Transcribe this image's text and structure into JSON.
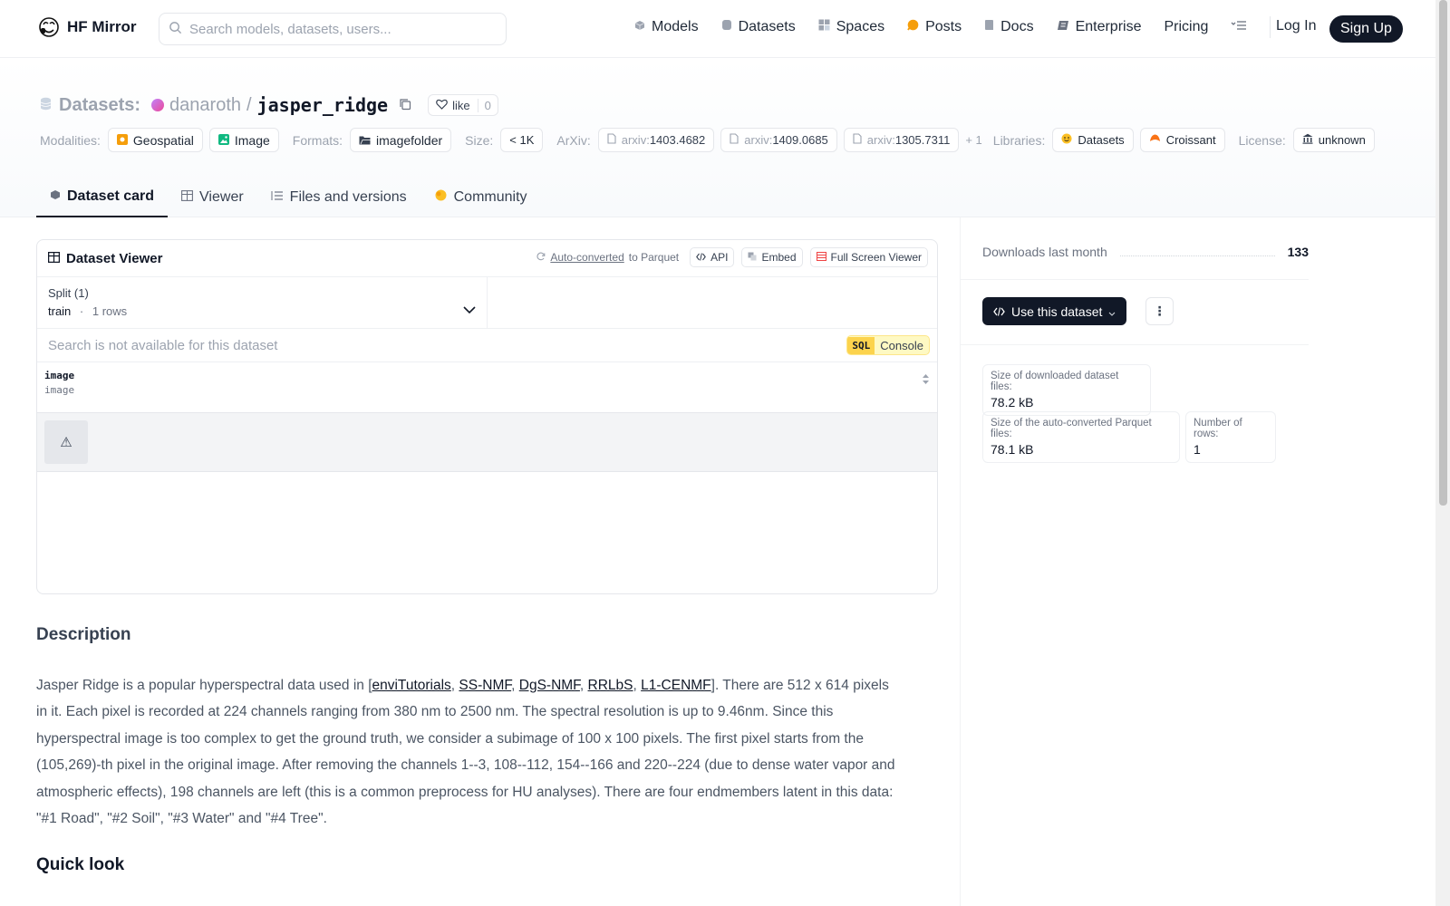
{
  "header": {
    "brand": "HF Mirror",
    "search_placeholder": "Search models, datasets, users...",
    "nav": [
      {
        "label": "Models",
        "icon": "cube-icon",
        "color": "#9ca3af"
      },
      {
        "label": "Datasets",
        "icon": "database-icon",
        "color": "#9ca3af"
      },
      {
        "label": "Spaces",
        "icon": "grid-icon",
        "color": "#9ca3af"
      },
      {
        "label": "Posts",
        "icon": "posts-icon",
        "color": "#f59e0b"
      },
      {
        "label": "Docs",
        "icon": "doc-icon",
        "color": "#9ca3af"
      },
      {
        "label": "Enterprise",
        "icon": "enterprise-icon",
        "color": "#6b7280"
      },
      {
        "label": "Pricing",
        "icon": "",
        "color": ""
      }
    ],
    "login": "Log In",
    "signup": "Sign Up"
  },
  "dataset": {
    "prefix": "Datasets:",
    "owner": "danaroth",
    "sep": "/",
    "name": "jasper_ridge",
    "like_label": "like",
    "like_count": "0"
  },
  "tags": {
    "modalities_label": "Modalities:",
    "modalities": [
      "Geospatial",
      "Image"
    ],
    "formats_label": "Formats:",
    "formats": [
      "imagefolder"
    ],
    "size_label": "Size:",
    "size": "< 1K",
    "arxiv_label": "ArXiv:",
    "arxiv": [
      {
        "prefix": "arxiv:",
        "id": "1403.4682"
      },
      {
        "prefix": "arxiv:",
        "id": "1409.0685"
      },
      {
        "prefix": "arxiv:",
        "id": "1305.7311"
      }
    ],
    "arxiv_more": "+ 1",
    "libraries_label": "Libraries:",
    "libraries": [
      "Datasets",
      "Croissant"
    ],
    "license_label": "License:",
    "license": "unknown"
  },
  "tabs": [
    {
      "label": "Dataset card",
      "active": true
    },
    {
      "label": "Viewer",
      "active": false
    },
    {
      "label": "Files and versions",
      "active": false
    },
    {
      "label": "Community",
      "active": false
    }
  ],
  "viewer": {
    "title": "Dataset Viewer",
    "auto_converted": "Auto-converted",
    "to_parquet": "to Parquet",
    "api": "API",
    "embed": "Embed",
    "fullscreen": "Full Screen Viewer",
    "split_label": "Split (1)",
    "split_value": "train",
    "split_dot": "·",
    "split_rows": "1 rows",
    "search_unavailable": "Search is not available for this dataset",
    "sql": "SQL",
    "console": "Console",
    "column_name": "image",
    "column_type": "image",
    "cell_icon": "⚠"
  },
  "card": {
    "description_heading": "Description",
    "para_start": "Jasper Ridge is a popular hyperspectral data used in [",
    "links": [
      "enviTutorials",
      "SS-NMF",
      "DgS-NMF",
      "RRLbS",
      "L1-CENMF"
    ],
    "para_rest": "]. There are 512 x 614 pixels in it. Each pixel is recorded at 224 channels ranging from 380 nm to 2500 nm. The spectral resolution is up to 9.46nm. Since this hyperspectral image is too complex to get the ground truth, we consider a subimage of 100 x 100 pixels. The first pixel starts from the (105,269)-th pixel in the original image. After removing the channels 1--3, 108--112, 154--166 and 220--224 (due to dense water vapor and atmospheric effects), 198 channels are left (this is a common preprocess for HU analyses). There are four endmembers latent in this data: \"#1 Road\", \"#2 Soil\", \"#3 Water\" and \"#4 Tree\".",
    "quicklook_heading": "Quick look"
  },
  "sidebar": {
    "downloads_label": "Downloads last month",
    "downloads_value": "133",
    "use_dataset": "Use this dataset",
    "more": "⋮",
    "stats": [
      {
        "label": "Size of downloaded dataset files:",
        "value": "78.2 kB"
      },
      {
        "label": "Size of the auto-converted Parquet files:",
        "value": "78.1 kB"
      },
      {
        "label": "Number of rows:",
        "value": "1"
      }
    ]
  }
}
